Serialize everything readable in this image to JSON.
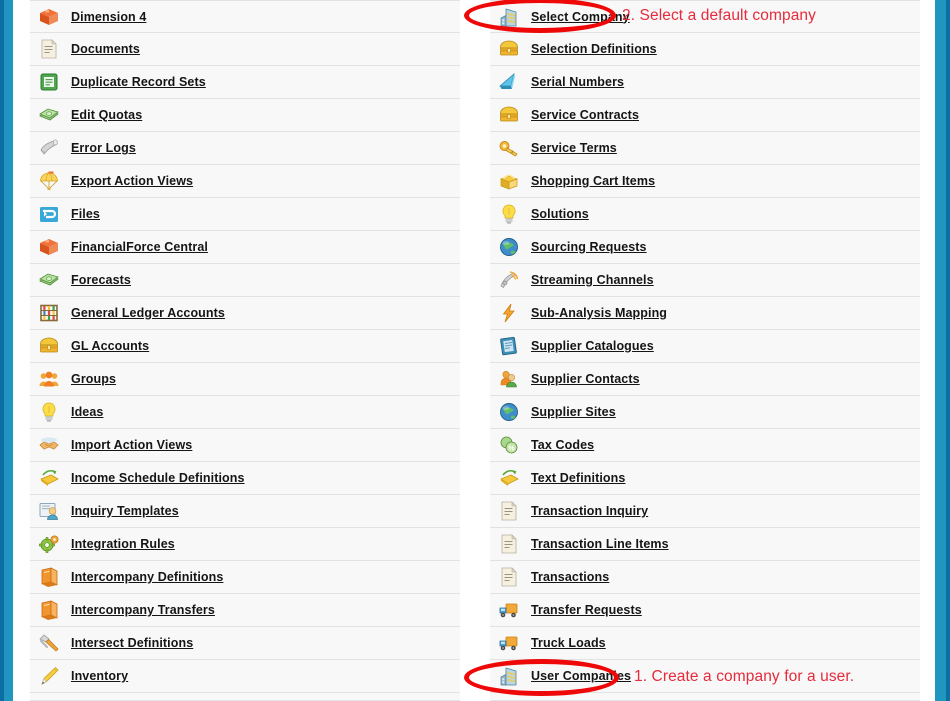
{
  "theme": {
    "accent_blue": "#2095c0",
    "accent_blue_dark": "#0d6ea3",
    "row_background": "#f8f8f8",
    "row_separator": "#e2e2e2",
    "link_color": "#151515",
    "annotation_red": "#e52b3c",
    "ellipse_red": "#ee0808"
  },
  "left_column": {
    "items": [
      {
        "label": "Dimension 4",
        "icon": "orange-box-icon"
      },
      {
        "label": "Documents",
        "icon": "document-page-icon"
      },
      {
        "label": "Duplicate Record Sets",
        "icon": "green-list-icon"
      },
      {
        "label": "Edit Quotas",
        "icon": "green-money-stack-icon"
      },
      {
        "label": "Error Logs",
        "icon": "gray-horn-icon"
      },
      {
        "label": "Export Action Views",
        "icon": "yellow-parachute-icon"
      },
      {
        "label": "Files",
        "icon": "blue-folder-icon"
      },
      {
        "label": "FinancialForce Central",
        "icon": "orange-box-icon"
      },
      {
        "label": "Forecasts",
        "icon": "green-money-stack-icon"
      },
      {
        "label": "General Ledger Accounts",
        "icon": "abacus-icon"
      },
      {
        "label": "GL Accounts",
        "icon": "gold-chest-icon"
      },
      {
        "label": "Groups",
        "icon": "orange-people-icon"
      },
      {
        "label": "Ideas",
        "icon": "yellow-lightbulb-icon"
      },
      {
        "label": "Import Action Views",
        "icon": "handshake-icon"
      },
      {
        "label": "Income Schedule Definitions",
        "icon": "yellow-envelope-arrow-icon"
      },
      {
        "label": "Inquiry Templates",
        "icon": "person-card-icon"
      },
      {
        "label": "Integration Rules",
        "icon": "green-gear-icon"
      },
      {
        "label": "Intercompany Definitions",
        "icon": "orange-book-icon"
      },
      {
        "label": "Intercompany Transfers",
        "icon": "orange-book-icon"
      },
      {
        "label": "Intersect Definitions",
        "icon": "hammer-tool-icon"
      },
      {
        "label": "Inventory",
        "icon": "yellow-pencil-icon"
      }
    ]
  },
  "right_column": {
    "items": [
      {
        "label": "Select Company",
        "icon": "building-chart-icon",
        "highlighted": true
      },
      {
        "label": "Selection Definitions",
        "icon": "gold-chest-icon"
      },
      {
        "label": "Serial Numbers",
        "icon": "blue-triangle-icon"
      },
      {
        "label": "Service Contracts",
        "icon": "gold-chest-icon"
      },
      {
        "label": "Service Terms",
        "icon": "gold-key-icon"
      },
      {
        "label": "Shopping Cart Items",
        "icon": "open-box-icon"
      },
      {
        "label": "Solutions",
        "icon": "yellow-lightbulb-icon"
      },
      {
        "label": "Sourcing Requests",
        "icon": "globe-icon"
      },
      {
        "label": "Streaming Channels",
        "icon": "satellite-icon"
      },
      {
        "label": "Sub-Analysis Mapping",
        "icon": "orange-lightning-icon"
      },
      {
        "label": "Supplier Catalogues",
        "icon": "blue-catalog-icon"
      },
      {
        "label": "Supplier Contacts",
        "icon": "two-people-icon"
      },
      {
        "label": "Supplier Sites",
        "icon": "globe-icon"
      },
      {
        "label": "Tax Codes",
        "icon": "green-percent-coin-icon"
      },
      {
        "label": "Text Definitions",
        "icon": "yellow-envelope-arrow-icon"
      },
      {
        "label": "Transaction Inquiry",
        "icon": "document-page-icon"
      },
      {
        "label": "Transaction Line Items",
        "icon": "document-page-icon"
      },
      {
        "label": "Transactions",
        "icon": "document-page-icon"
      },
      {
        "label": "Transfer Requests",
        "icon": "truck-icon"
      },
      {
        "label": "Truck Loads",
        "icon": "truck-icon"
      },
      {
        "label": "User Companies",
        "icon": "building-chart-icon",
        "highlighted": true
      }
    ]
  },
  "annotations": [
    {
      "id": "annot-1",
      "text": "1. Create a company for a user."
    },
    {
      "id": "annot-2",
      "text": "2. Select a default company"
    }
  ]
}
